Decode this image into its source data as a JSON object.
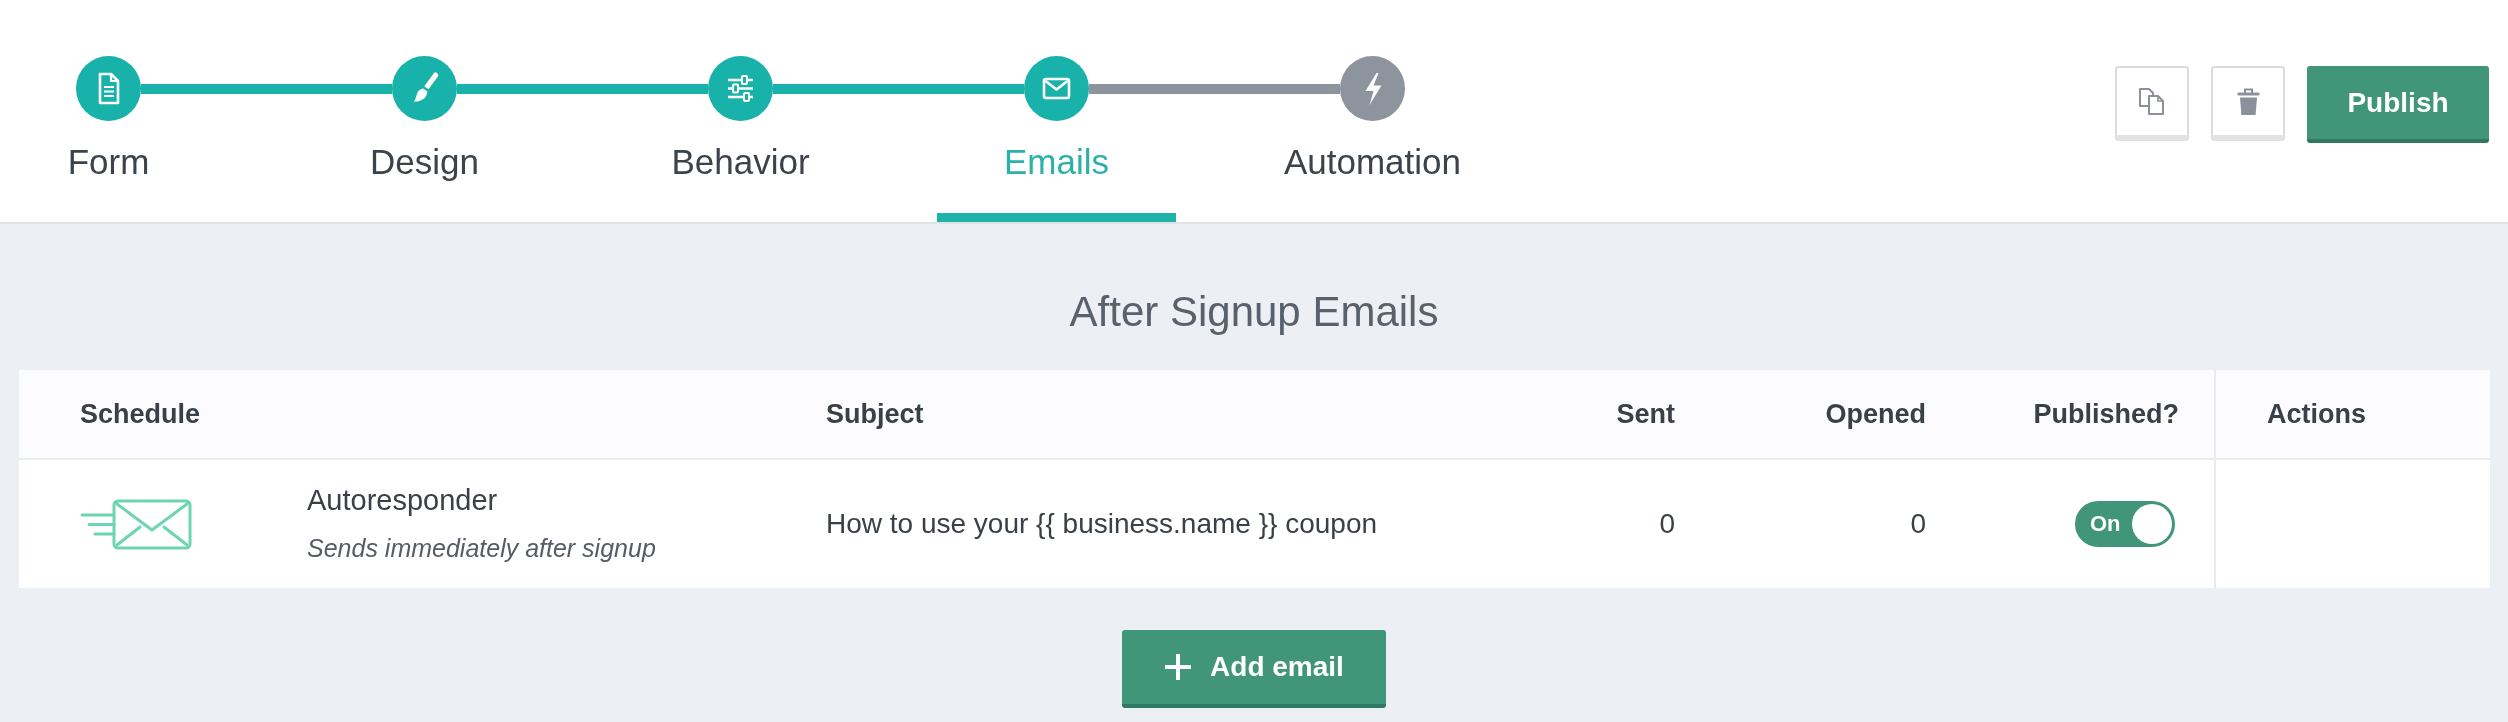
{
  "steps": [
    {
      "label": "Form",
      "reached": true,
      "selected": false
    },
    {
      "label": "Design",
      "reached": true,
      "selected": false
    },
    {
      "label": "Behavior",
      "reached": true,
      "selected": false
    },
    {
      "label": "Emails",
      "reached": true,
      "selected": true
    },
    {
      "label": "Automation",
      "reached": false,
      "selected": false
    }
  ],
  "publish_button": "Publish",
  "section_title": "After Signup Emails",
  "table": {
    "columns": [
      "Schedule",
      "Subject",
      "Sent",
      "Opened",
      "Published?",
      "Actions"
    ],
    "rows": [
      {
        "name": "Autoresponder",
        "description": "Sends immediately after signup",
        "subject": "How to use your {{ business.name }} coupon",
        "sent": "0",
        "opened": "0",
        "published": {
          "on": true,
          "label": "On"
        }
      }
    ]
  },
  "add_button": "Add email"
}
